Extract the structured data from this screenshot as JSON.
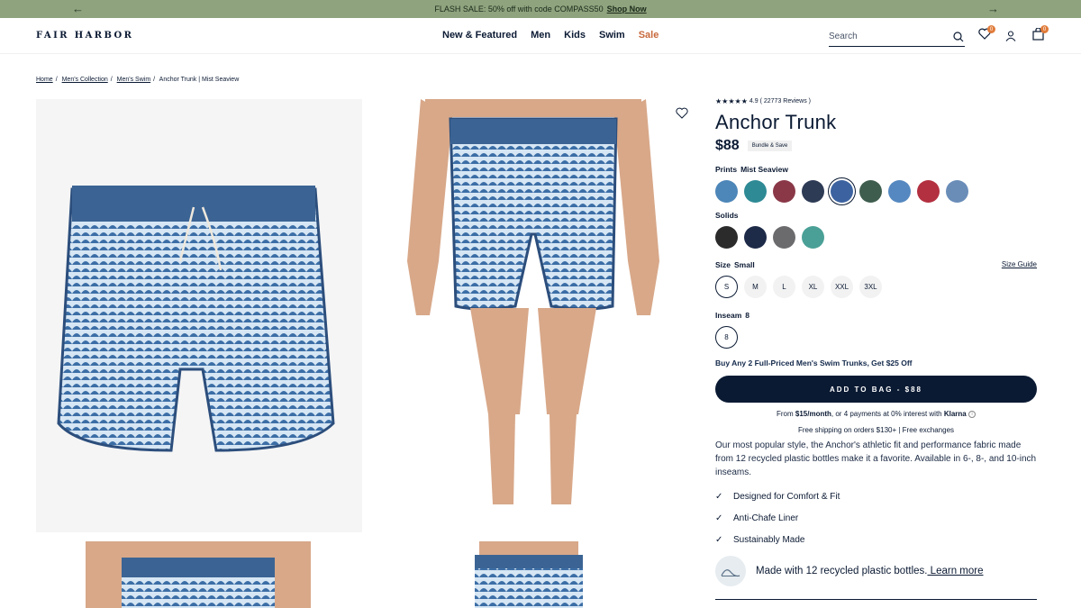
{
  "promo": {
    "text": "FLASH SALE: 50% off with code COMPASS50",
    "link": "Shop Now"
  },
  "header": {
    "logo": "FAIR HARBOR",
    "nav": [
      "New & Featured",
      "Men",
      "Kids",
      "Swim",
      "Sale"
    ],
    "search_placeholder": "Search",
    "wishlist_count": "0",
    "cart_count": "0"
  },
  "breadcrumb": [
    "Home",
    "Men's Collection",
    "Men's Swim",
    "Anchor Trunk | Mist Seaview"
  ],
  "product": {
    "rating": "4.9",
    "reviews": "( 22773 Reviews )",
    "title": "Anchor Trunk",
    "price": "$88",
    "bundle": "Bundle & Save",
    "prints_label": "Prints",
    "prints_value": "Mist Seaview",
    "print_colors": [
      "#4d86b8",
      "#2e8a95",
      "#8a3848",
      "#2e3b55",
      "#3c63a0",
      "#3e5d4e",
      "#5588c0",
      "#b33040",
      "#6a8db8"
    ],
    "selected_print": 4,
    "solids_label": "Solids",
    "solid_colors": [
      "#2b2b2b",
      "#1d2a48",
      "#6b6b6e",
      "#4aa096"
    ],
    "size_label": "Size",
    "size_value": "Small",
    "size_guide": "Size Guide",
    "sizes": [
      "S",
      "M",
      "L",
      "XL",
      "XXL",
      "3XL"
    ],
    "inseam_label": "Inseam",
    "inseam_value": "8",
    "inseams": [
      "8"
    ],
    "promo": "Buy Any 2 Full-Priced Men's Swim Trunks, Get $25 Off",
    "add_to_bag": "ADD TO BAG - $88",
    "klarna_pre": "From ",
    "klarna_amount": "$15/month",
    "klarna_post": ", or 4 payments at 0% interest with ",
    "klarna_brand": "Klarna",
    "shipping": "Free shipping on orders $130+ | Free exchanges",
    "description": "Our most popular style, the Anchor's athletic fit and performance fabric made from 12 recycled plastic bottles make it a favorite. Available in 6-, 8-, and 10-inch inseams.",
    "features": [
      "Designed for Comfort & Fit",
      "Anti-Chafe Liner",
      "Sustainably Made"
    ],
    "recycled_text": "Made with 12 recycled plastic bottles.",
    "learn_more": " Learn more"
  },
  "icons": {
    "prev": "arrow-left-icon",
    "next": "arrow-right-icon",
    "search": "search-icon",
    "wishlist": "heart-icon",
    "account": "user-icon",
    "cart": "bag-icon",
    "check": "check-icon"
  }
}
